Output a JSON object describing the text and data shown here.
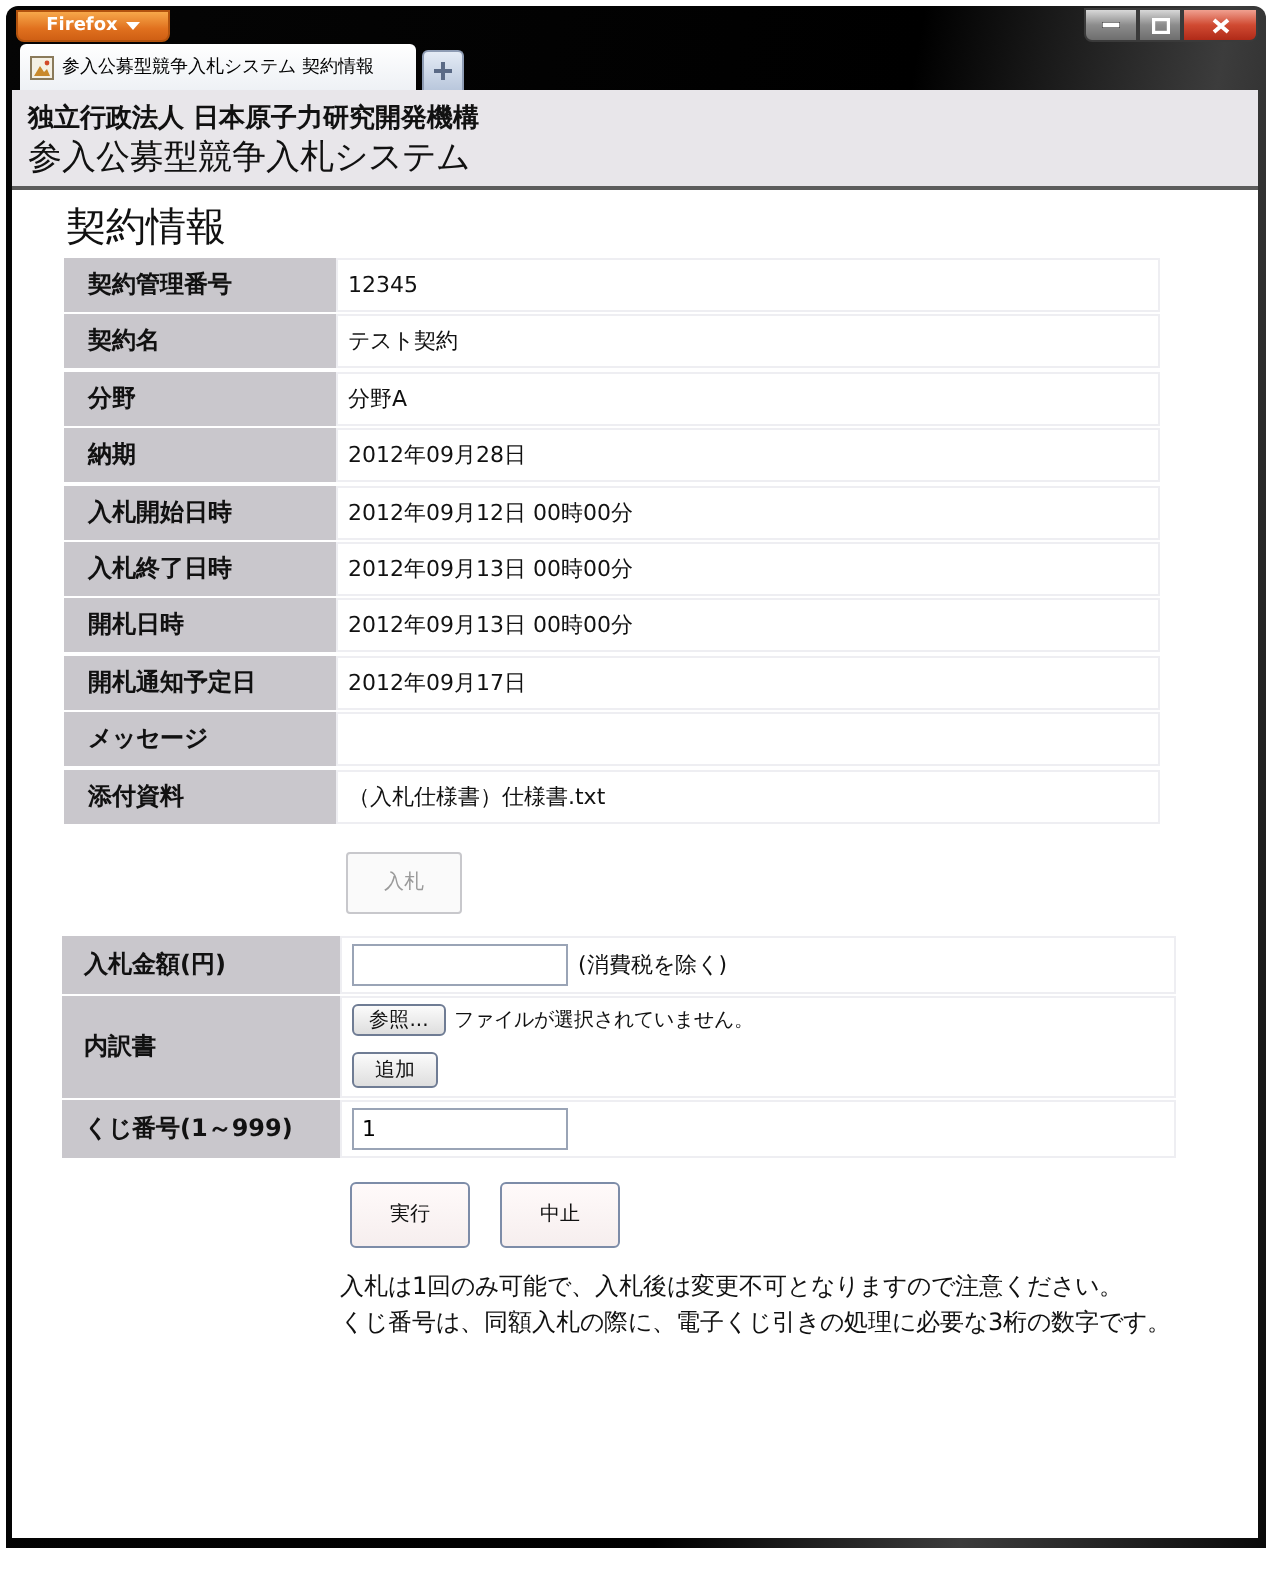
{
  "window": {
    "app_menu": "Firefox"
  },
  "tabs": [
    {
      "label": "参入公募型競争入札システム 契約情報",
      "selected": true
    }
  ],
  "site_header": {
    "organization": "独立行政法人 日本原子力研究開発機構",
    "system_name": "参入公募型競争入札システム"
  },
  "page_title": "契約情報",
  "contract_details": [
    {
      "label": "契約管理番号",
      "value": "12345"
    },
    {
      "label": "契約名",
      "value": "テスト契約"
    },
    {
      "label": "分野",
      "value": "分野A"
    },
    {
      "label": "納期",
      "value": "2012年09月28日"
    },
    {
      "label": "入札開始日時",
      "value": "2012年09月12日 00時00分"
    },
    {
      "label": "入札終了日時",
      "value": "2012年09月13日 00時00分"
    },
    {
      "label": "開札日時",
      "value": "2012年09月13日 00時00分"
    },
    {
      "label": "開札通知予定日",
      "value": "2012年09月17日"
    },
    {
      "label": "メッセージ"
    },
    {
      "label": "添付資料",
      "value": "（入札仕様書）仕様書.txt"
    }
  ],
  "bid_button": {
    "label": "入札",
    "disabled": true
  },
  "bid_form": [
    {
      "kind": "input",
      "label": "入札金額(円)",
      "note": "(消費税を除く)"
    },
    {
      "kind": "file",
      "label": "内訳書",
      "browse_button": "参照...",
      "file_status": "ファイルが選択されていません。",
      "add_button": "追加"
    },
    {
      "kind": "input",
      "label": "くじ番号(1～999)",
      "value": "1"
    }
  ],
  "actions": [
    {
      "label": "実行"
    },
    {
      "label": "中止"
    }
  ],
  "notes": [
    "入札は1回のみ可能で、入札後は変更不可となりますので注意ください。",
    "くじ番号は、同額入札の際に、電子くじ引きの処理に必要な3桁の数字です。"
  ]
}
